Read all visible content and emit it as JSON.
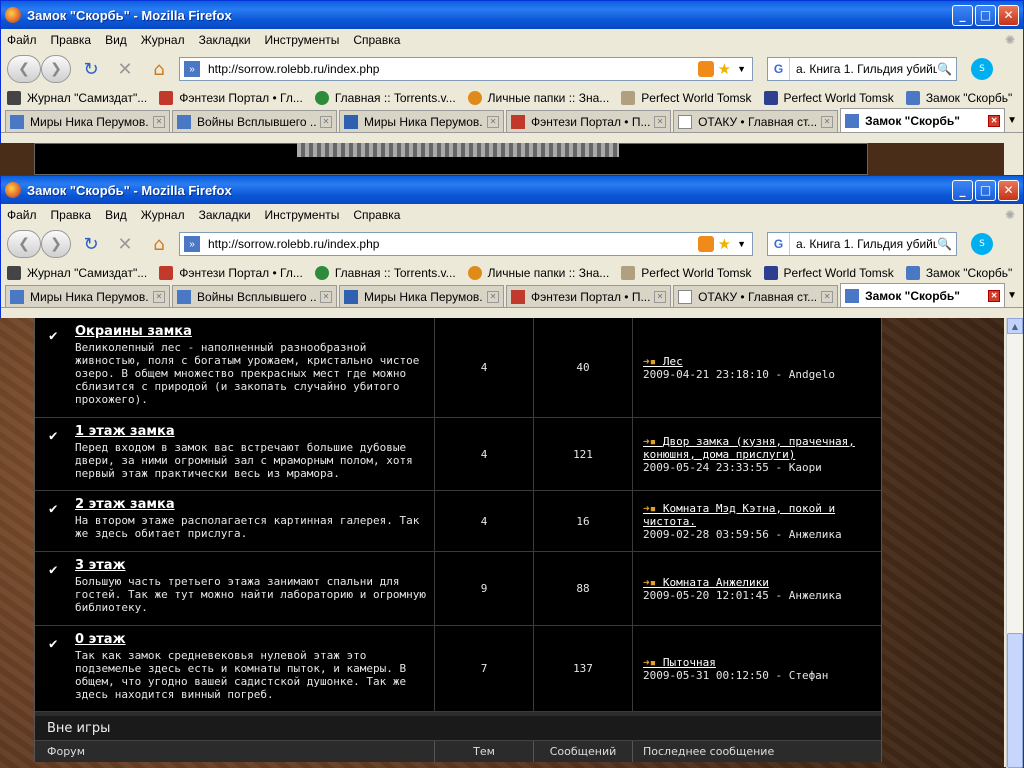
{
  "window": {
    "title": "Замок \"Скорбь\" - Mozilla Firefox"
  },
  "menu": [
    "Файл",
    "Правка",
    "Вид",
    "Журнал",
    "Закладки",
    "Инструменты",
    "Справка"
  ],
  "url": "http://sorrow.rolebb.ru/index.php",
  "search_value": "а. Книга 1. Гильдия убийц",
  "bookmarks": [
    {
      "label": "Журнал \"Самиздат\"...",
      "icon": "lib-ru-icon",
      "color": "#444444"
    },
    {
      "label": "Фэнтези Портал • Гл...",
      "icon": "dragon-icon",
      "color": "#c0392b"
    },
    {
      "label": "Главная :: Torrents.v...",
      "icon": "torrent-icon",
      "color": "#2e8b3a"
    },
    {
      "label": "Личные папки :: Зна...",
      "icon": "gear-icon",
      "color": "#e08a1a"
    },
    {
      "label": "Perfect World Tomsk",
      "icon": "wings-icon",
      "color": "#b0a080"
    },
    {
      "label": "Perfect World Tomsk",
      "icon": "shield-icon",
      "color": "#2d3f8f"
    },
    {
      "label": "Замок \"Скорбь\"",
      "icon": "site-icon",
      "color": "#4a78c5"
    }
  ],
  "tabs": [
    {
      "label": "Миры Ника Перумов...",
      "icon": "google-icon",
      "color": "#4a78c5"
    },
    {
      "label": "Войны Всплывшего ...",
      "icon": "google-icon",
      "color": "#4a78c5"
    },
    {
      "label": "Миры Ника Перумов...",
      "icon": "fl-icon",
      "color": "#3060b0"
    },
    {
      "label": "Фэнтези Портал • П...",
      "icon": "dragon-icon",
      "color": "#c0392b"
    },
    {
      "label": "ОТАКУ • Главная ст...",
      "icon": "page-icon",
      "color": "#ffffff"
    },
    {
      "label": "Замок \"Скорбь\"",
      "icon": "site-icon",
      "color": "#4a78c5",
      "active": true
    }
  ],
  "forums": [
    {
      "title": "Окраины замка",
      "desc": "Великолепный лес - наполненный разнообразной живностью, поля с богатым урожаем, кристально чистое озеро. В общем множество прекрасных мест где можно сблизится с природой (и закопать случайно убитого прохожего).",
      "topics": "4",
      "posts": "40",
      "last_title": "Лес",
      "last_meta": "2009-04-21 23:18:10 - Andgelo",
      "h": 100
    },
    {
      "title": "1 этаж замка",
      "desc": "Перед входом в замок вас встречают большие дубовые двери, за ними огромный зал с мраморным полом, хотя первый этаж практически весь из мрамора.",
      "topics": "4",
      "posts": "121",
      "last_title": "Двор замка (кузня, прачечная, конюшня, дома прислуги)",
      "last_meta": "2009-05-24 23:33:55 - Каори",
      "h": 73
    },
    {
      "title": "2 этаж замка",
      "desc": "На втором этаже располагается картинная галерея. Так же здесь обитает прислуга.",
      "topics": "4",
      "posts": "16",
      "last_title": "Комната Мэд Кэтна, покой и чистота.",
      "last_meta": "2009-02-28 03:59:56 - Анжелика",
      "h": 61
    },
    {
      "title": "3 этаж",
      "desc": "Большую часть третьего этажа занимают спальни для гостей. Так же тут можно найти лабораторию и огромную библиотеку.",
      "topics": "9",
      "posts": "88",
      "last_title": "Комната Анжелики",
      "last_meta": "2009-05-20 12:01:45 - Анжелика",
      "h": 74
    },
    {
      "title": "0 этаж",
      "desc": "Так как замок средневековья нулевой этаж это подземелье здесь есть и комнаты пыток, и камеры. В общем, что угодно вашей садистской душонке. Так же здесь находится винный погреб.",
      "topics": "7",
      "posts": "137",
      "last_title": "Пыточная",
      "last_meta": "2009-05-31 00:12:50 - Стефан",
      "h": 86
    }
  ],
  "section": {
    "title": "Вне игры",
    "col_forum": "Форум",
    "col_topics": "Тем",
    "col_posts": "Сообщений",
    "col_last": "Последнее сообщение"
  }
}
